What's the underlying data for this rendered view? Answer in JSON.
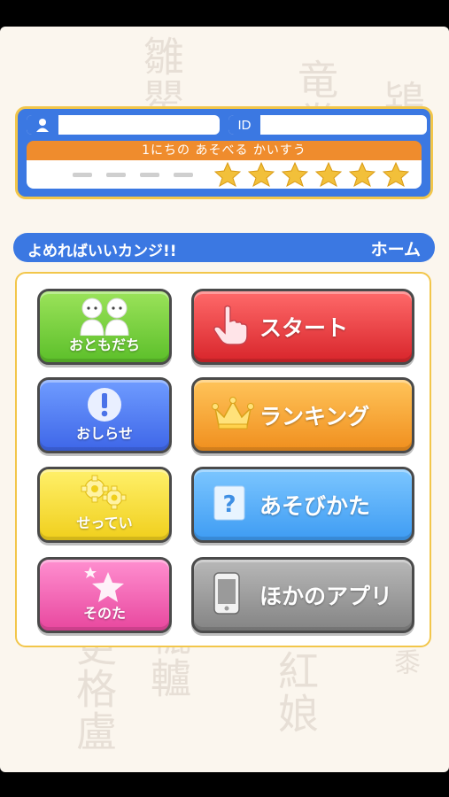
{
  "player": {
    "name_value": "",
    "id_label": "ID",
    "id_value": "",
    "plays_label": "1にちの あそべる かいすう",
    "stars_filled": 6,
    "dashes": 4
  },
  "titlebar": {
    "app_title": "よめればいいカンジ!!",
    "home_label": "ホーム"
  },
  "menu": {
    "friends_label": "おともだち",
    "notice_label": "おしらせ",
    "settings_label": "せってい",
    "other_label": "そのた",
    "start_label": "スタート",
    "ranking_label": "ランキング",
    "howto_label": "あそびかた",
    "otherapps_label": "ほかのアプリ"
  },
  "background_kanji": {
    "col1": "雛罌",
    "col2": "竜巻",
    "col3": "鴇",
    "col4": "更格盧",
    "col5": "轆轤",
    "col6": "紅娘",
    "col7": "蜀黍"
  },
  "colors": {
    "accent_blue": "#3b78e2",
    "border_gold": "#f2c64a",
    "plays_orange": "#ef8c2d",
    "star_gold": "#f2c03a"
  }
}
